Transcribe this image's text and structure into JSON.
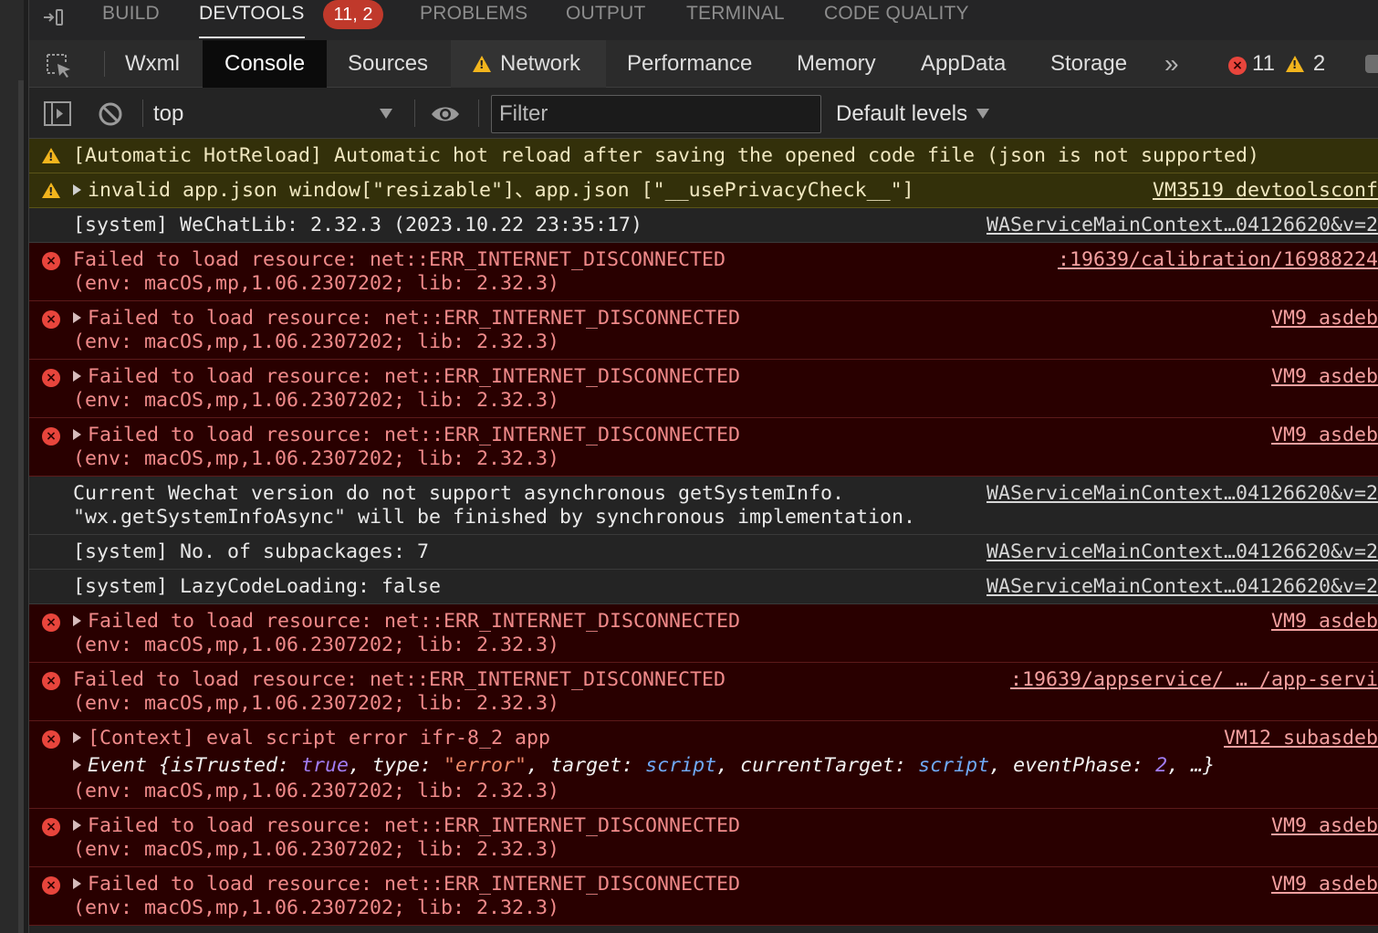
{
  "panel_tabs": {
    "build": "BUILD",
    "devtools": "DEVTOOLS",
    "devtools_badge": "11, 2",
    "problems": "PROBLEMS",
    "output": "OUTPUT",
    "terminal": "TERMINAL",
    "code_quality": "CODE QUALITY"
  },
  "devtools_tabs": {
    "wxml": "Wxml",
    "console": "Console",
    "sources": "Sources",
    "network": "Network",
    "performance": "Performance",
    "memory": "Memory",
    "appdata": "AppData",
    "storage": "Storage",
    "more": "»",
    "error_count": "11",
    "warning_count": "2"
  },
  "filter_bar": {
    "context": "top",
    "filter_placeholder": "Filter",
    "levels": "Default levels"
  },
  "messages": [
    {
      "level": "warning",
      "text": "[Automatic HotReload] Automatic hot reload after saving the opened code file (json is not supported)",
      "source": ""
    },
    {
      "level": "warning",
      "text": "invalid app.json window[\"resizable\"]、app.json [\"__usePrivacyCheck__\"]",
      "source": "VM3519 devtoolsconf"
    },
    {
      "level": "info",
      "text": "[system] WeChatLib: 2.32.3 (2023.10.22 23:35:17)",
      "source": "WAServiceMainContext…04126620&v=2"
    },
    {
      "level": "error",
      "text": "Failed to load resource: net::ERR_INTERNET_DISCONNECTED",
      "detail": "(env: macOS,mp,1.06.2307202; lib: 2.32.3)",
      "source": ":19639/calibration/16988224"
    },
    {
      "level": "error",
      "text": "Failed to load resource: net::ERR_INTERNET_DISCONNECTED",
      "detail": "(env: macOS,mp,1.06.2307202; lib: 2.32.3)",
      "source": "VM9 asdeb"
    },
    {
      "level": "error",
      "text": "Failed to load resource: net::ERR_INTERNET_DISCONNECTED",
      "detail": "(env: macOS,mp,1.06.2307202; lib: 2.32.3)",
      "source": "VM9 asdeb"
    },
    {
      "level": "error",
      "text": "Failed to load resource: net::ERR_INTERNET_DISCONNECTED",
      "detail": "(env: macOS,mp,1.06.2307202; lib: 2.32.3)",
      "source": "VM9 asdeb"
    },
    {
      "level": "info",
      "text": "Current Wechat version do not support asynchronous getSystemInfo.",
      "detail": "\"wx.getSystemInfoAsync\" will be finished by synchronous implementation.",
      "source": "WAServiceMainContext…04126620&v=2"
    },
    {
      "level": "info",
      "text": "[system] No. of subpackages: 7",
      "source": "WAServiceMainContext…04126620&v=2"
    },
    {
      "level": "info",
      "text": "[system] LazyCodeLoading: false",
      "source": "WAServiceMainContext…04126620&v=2"
    },
    {
      "level": "error",
      "text": "Failed to load resource: net::ERR_INTERNET_DISCONNECTED",
      "detail": "(env: macOS,mp,1.06.2307202; lib: 2.32.3)",
      "source": "VM9 asdeb"
    },
    {
      "level": "error",
      "text": "Failed to load resource: net::ERR_INTERNET_DISCONNECTED",
      "detail": "(env: macOS,mp,1.06.2307202; lib: 2.32.3)",
      "source": ":19639/appservice/ … /app-servi"
    },
    {
      "level": "error",
      "text": "[Context] eval script error ifr-8_2 app",
      "event": {
        "prefix": "Event {isTrusted: ",
        "is_trusted": "true",
        "type_label": ", type: ",
        "type": "\"error\"",
        "target_label": ", target: ",
        "target": "script",
        "current_target_label": ", currentTarget: ",
        "current_target": "script",
        "phase_label": ", eventPhase: ",
        "phase": "2",
        "suffix": ", …}"
      },
      "detail": "(env: macOS,mp,1.06.2307202; lib: 2.32.3)",
      "source": "VM12 subasdeb"
    },
    {
      "level": "error",
      "text": "Failed to load resource: net::ERR_INTERNET_DISCONNECTED",
      "detail": "(env: macOS,mp,1.06.2307202; lib: 2.32.3)",
      "source": "VM9 asdeb"
    },
    {
      "level": "error",
      "text": "Failed to load resource: net::ERR_INTERNET_DISCONNECTED",
      "detail": "(env: macOS,mp,1.06.2307202; lib: 2.32.3)",
      "source": "VM9 asdeb"
    }
  ],
  "colors": {
    "error_bg": "#290000",
    "error_text": "#f08a8a",
    "warning_bg": "#33300a",
    "warning_icon": "#f2b51d",
    "error_icon": "#e8453c",
    "badge": "#c0392b"
  }
}
